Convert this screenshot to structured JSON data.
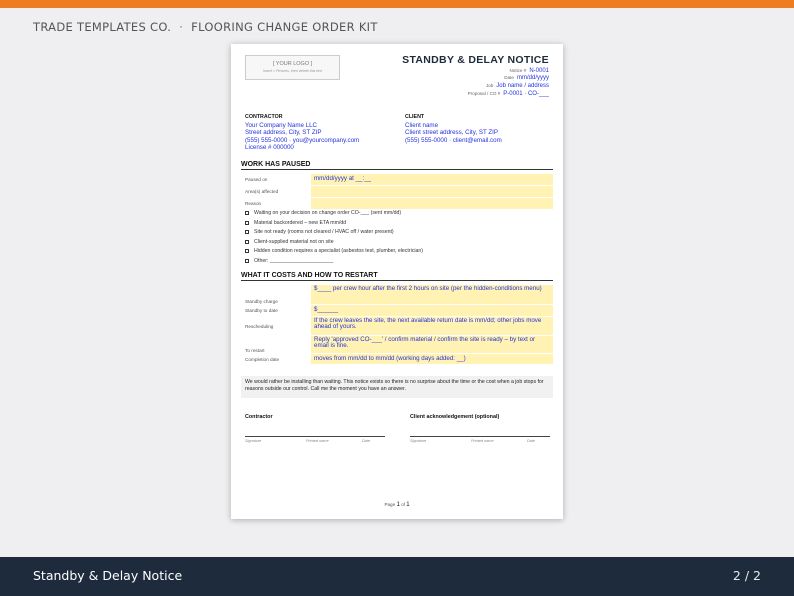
{
  "brand": {
    "company": "TRADE TEMPLATES CO.",
    "separator": "·",
    "kit": "FLOORING CHANGE ORDER KIT"
  },
  "footer": {
    "title": "Standby & Delay Notice",
    "page_indicator": "2 / 2"
  },
  "document": {
    "logo": {
      "placeholder": "[ YOUR LOGO ]",
      "hint": "Insert > Pictures, then delete this text"
    },
    "title": "STANDBY & DELAY NOTICE",
    "meta": [
      {
        "label": "Notice #",
        "value": "N-0001"
      },
      {
        "label": "Date",
        "value": "mm/dd/yyyy"
      },
      {
        "label": "Job",
        "value": "Job name / address"
      },
      {
        "label": "Proposal / CO #",
        "value": "P-0001 · CO-___"
      }
    ],
    "contractor": {
      "heading": "CONTRACTOR",
      "lines": [
        "Your Company Name LLC",
        "Street address, City, ST ZIP",
        "(555) 555-0000 · you@yourcompany.com",
        "License # 000000"
      ]
    },
    "client": {
      "heading": "CLIENT",
      "lines": [
        "Client name",
        "Client street address, City, ST ZIP",
        "(555) 555-0000 · client@email.com"
      ]
    },
    "paused_section": {
      "heading": "WORK HAS PAUSED",
      "rows": [
        {
          "label": "Paused on",
          "value": "mm/dd/yyyy at __:__"
        },
        {
          "label": "Area(s) affected",
          "value": ""
        },
        {
          "label": "Reason",
          "value": ""
        }
      ],
      "reasons": [
        "Waiting on your decision on change order CO-___ (sent mm/dd)",
        "Material backordered – new ETA mm/dd",
        "Site not ready (rooms not cleared / HVAC off / water present)",
        "Client-supplied material not on site",
        "Hidden condition requires a specialist (asbestos test, plumber, electrician)",
        "Other: ______________________"
      ]
    },
    "costs_section": {
      "heading": "WHAT IT COSTS AND HOW TO RESTART",
      "rows": [
        {
          "label": "Standby charge",
          "value": "$____ per crew hour after the first 2 hours on site (per the hidden-conditions menu)"
        },
        {
          "label": "Standby to date",
          "value": "$______"
        },
        {
          "label": "Rescheduling",
          "value": "If the crew leaves the site, the next available return date is mm/dd; other jobs move ahead of yours."
        },
        {
          "label": "To restart",
          "value": "Reply 'approved CO-___' / confirm material / confirm the site is ready – by text or email is fine."
        },
        {
          "label": "Completion date",
          "value": "moves from mm/dd to mm/dd (working days added: __)"
        }
      ]
    },
    "note": "We would rather be installing than waiting. This notice exists so there is no surprise about the time or the cost when a job stops for reasons outside our control. Call me the moment you have an answer.",
    "signatures": [
      {
        "heading": "Contractor",
        "captions": [
          "Signature",
          "Printed name",
          "Date"
        ]
      },
      {
        "heading": "Client acknowledgement (optional)",
        "captions": [
          "Signature",
          "Printed name",
          "Date"
        ]
      }
    ],
    "page": {
      "prefix": "Page",
      "current": "1",
      "of": "of",
      "total": "1"
    }
  }
}
